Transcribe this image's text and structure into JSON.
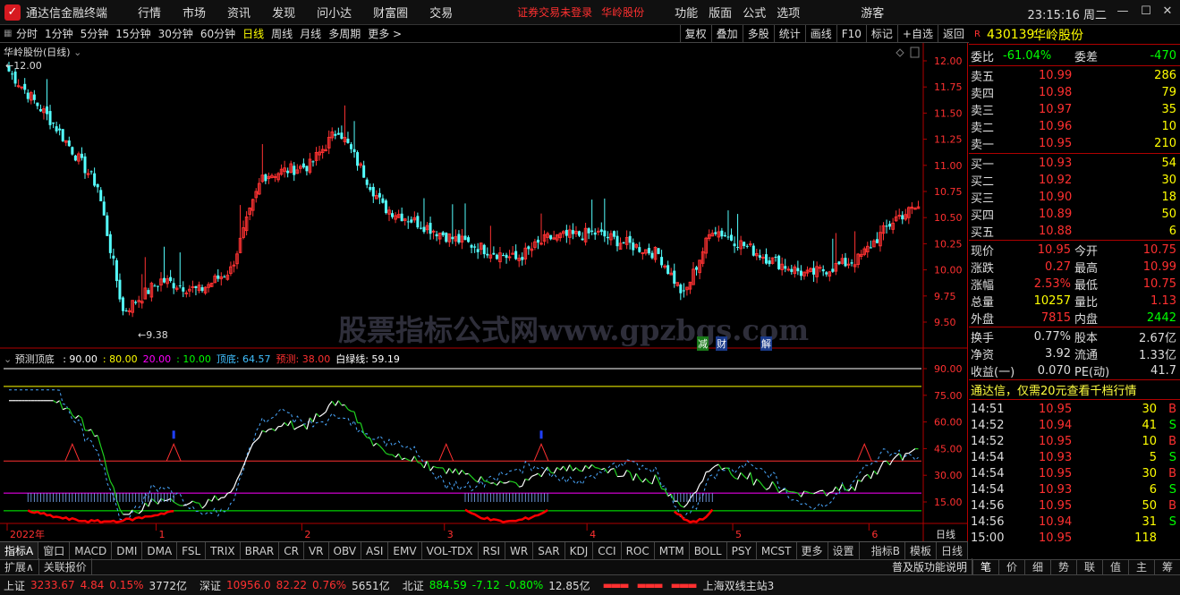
{
  "titlebar": {
    "app_name": "通达信金融终端",
    "menus": [
      "行情",
      "市场",
      "资讯",
      "发现",
      "问小达",
      "财富圈",
      "交易"
    ],
    "warning": "证券交易未登录",
    "stock_name": "华岭股份",
    "menus2": [
      "功能",
      "版面",
      "公式",
      "选项"
    ],
    "user": "游客",
    "clock": "23:15:16 周二"
  },
  "toolbar": {
    "timeframes": [
      "分时",
      "1分钟",
      "5分钟",
      "15分钟",
      "30分钟",
      "60分钟",
      "日线",
      "周线",
      "月线",
      "多周期",
      "更多 >"
    ],
    "active": "日线",
    "buttons": [
      "复权",
      "叠加",
      "多股",
      "统计",
      "画线",
      "F10",
      "标记",
      "+自选",
      "返回"
    ]
  },
  "chart": {
    "title": "华岭股份(日线)",
    "high_label": "12.00",
    "low_label": "9.38",
    "price_ticks": [
      "12.00",
      "11.75",
      "11.50",
      "11.25",
      "11.00",
      "10.75",
      "10.50",
      "10.25",
      "10.00",
      "9.75",
      "9.50"
    ],
    "watermark": "股票指标公式网www.gpzbgs.com",
    "events": [
      "减",
      "财",
      "解"
    ],
    "months": [
      "2022年",
      "1",
      "2",
      "3",
      "4",
      "5",
      "6"
    ],
    "period_label": "日线"
  },
  "indicator": {
    "name": "预测顶底",
    "items": [
      {
        "text": ": 90.00",
        "color": "#ffffff"
      },
      {
        "text": ": 80.00",
        "color": "#ffff00"
      },
      {
        "text": "20.00",
        "color": "#ff00ff"
      },
      {
        "text": ": 10.00",
        "color": "#00ff00"
      },
      {
        "text": "顶底: 64.57",
        "color": "#40c0ff"
      },
      {
        "text": "预测: 38.00",
        "color": "#ff3030"
      },
      {
        "text": "白绿线: 59.19",
        "color": "#ffffff"
      }
    ],
    "ticks": [
      "90.00",
      "75.00",
      "60.00",
      "45.00",
      "30.00",
      "15.00"
    ]
  },
  "quote": {
    "code": "430139",
    "name": "华岭股份",
    "wb_label": "委比",
    "wb": "-61.04%",
    "wc_label": "委差",
    "wc": "-470",
    "sells": [
      {
        "label": "卖五",
        "price": "10.99",
        "vol": "286"
      },
      {
        "label": "卖四",
        "price": "10.98",
        "vol": "79"
      },
      {
        "label": "卖三",
        "price": "10.97",
        "vol": "35"
      },
      {
        "label": "卖二",
        "price": "10.96",
        "vol": "10"
      },
      {
        "label": "卖一",
        "price": "10.95",
        "vol": "210"
      }
    ],
    "buys": [
      {
        "label": "买一",
        "price": "10.93",
        "vol": "54"
      },
      {
        "label": "买二",
        "price": "10.92",
        "vol": "30"
      },
      {
        "label": "买三",
        "price": "10.90",
        "vol": "18"
      },
      {
        "label": "买四",
        "price": "10.89",
        "vol": "50"
      },
      {
        "label": "买五",
        "price": "10.88",
        "vol": "6"
      }
    ],
    "stats": [
      [
        "现价",
        "10.95",
        "今开",
        "10.75"
      ],
      [
        "涨跌",
        "0.27",
        "最高",
        "10.99"
      ],
      [
        "涨幅",
        "2.53%",
        "最低",
        "10.75"
      ],
      [
        "总量",
        "10257",
        "量比",
        "1.13"
      ],
      [
        "外盘",
        "7815",
        "内盘",
        "2442"
      ]
    ],
    "stats2": [
      [
        "换手",
        "0.77%",
        "股本",
        "2.67亿"
      ],
      [
        "净资",
        "3.92",
        "流通",
        "1.33亿"
      ],
      [
        "收益(一)",
        "0.070",
        "PE(动)",
        "41.7"
      ]
    ],
    "ad": "通达信，仅需20元查看千档行情",
    "ticks": [
      {
        "t": "14:51",
        "p": "10.95",
        "v": "30",
        "s": "B"
      },
      {
        "t": "14:52",
        "p": "10.94",
        "v": "41",
        "s": "S"
      },
      {
        "t": "14:52",
        "p": "10.95",
        "v": "10",
        "s": "B"
      },
      {
        "t": "14:54",
        "p": "10.93",
        "v": "5",
        "s": "S"
      },
      {
        "t": "14:54",
        "p": "10.95",
        "v": "30",
        "s": "B"
      },
      {
        "t": "14:54",
        "p": "10.93",
        "v": "6",
        "s": "S"
      },
      {
        "t": "14:56",
        "p": "10.95",
        "v": "50",
        "s": "B"
      },
      {
        "t": "14:56",
        "p": "10.94",
        "v": "31",
        "s": "S"
      },
      {
        "t": "15:00",
        "p": "10.95",
        "v": "118",
        "s": ""
      }
    ]
  },
  "bottom_tabs": [
    "指标A",
    "窗口",
    "MACD",
    "DMI",
    "DMA",
    "FSL",
    "TRIX",
    "BRAR",
    "CR",
    "VR",
    "OBV",
    "ASI",
    "EMV",
    "VOL-TDX",
    "RSI",
    "WR",
    "SAR",
    "KDJ",
    "CCI",
    "ROC",
    "MTM",
    "BOLL",
    "PSY",
    "MCST",
    "更多",
    "设置"
  ],
  "bottom_right": [
    "指标B",
    "模板",
    "日线"
  ],
  "sub": {
    "left": [
      "扩展∧",
      "关联报价"
    ],
    "right": "普及版功能说明",
    "rtabs": [
      "笔",
      "价",
      "细",
      "势",
      "联",
      "值",
      "主",
      "筹"
    ]
  },
  "status": [
    {
      "name": "上证",
      "v": "3233.67",
      "c": "4.84",
      "p": "0.15%",
      "amt": "3772亿"
    },
    {
      "name": "深证",
      "v": "10956.0",
      "c": "82.22",
      "p": "0.76%",
      "amt": "5651亿"
    },
    {
      "name": "北证",
      "v": "884.59",
      "c": "-7.12",
      "p": "-0.80%",
      "amt": "12.85亿"
    }
  ],
  "station": "上海双线主站3"
}
